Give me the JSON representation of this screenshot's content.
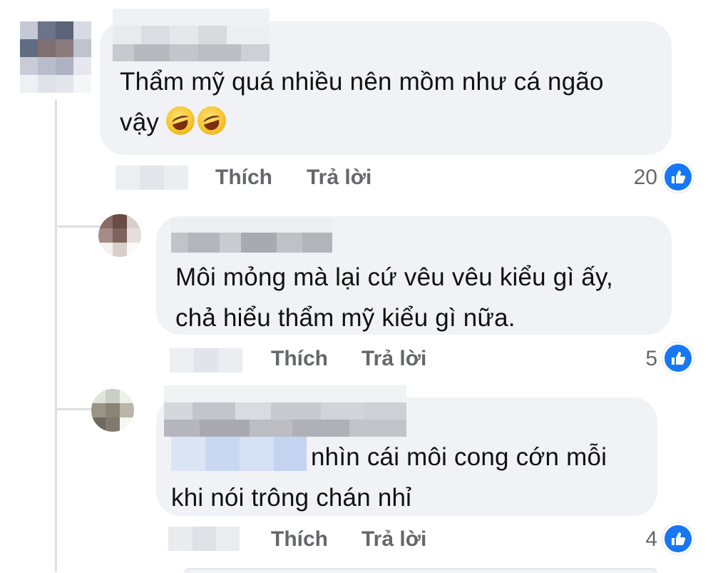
{
  "comments": [
    {
      "text_line1": "Thẩm mỹ quá nhiều nên mồm như cá ngão",
      "text_line2": "vậy",
      "emoji_names": [
        "rolling-on-floor-laughing-icon",
        "rolling-on-floor-laughing-icon"
      ],
      "like_label": "Thích",
      "reply_label": "Trả lời",
      "reaction_count": "20",
      "reaction_icon": "like-icon"
    },
    {
      "text_line1": "Môi mỏng mà lại cứ vêu vêu kiểu gì ấy,",
      "text_line2": "chả hiểu thẩm mỹ kiểu gì nữa.",
      "like_label": "Thích",
      "reply_label": "Trả lời",
      "reaction_count": "5",
      "reaction_icon": "like-icon"
    },
    {
      "text_line1": "nhìn cái môi cong cớn mỗi",
      "text_line2": "khi nói trông chán nhỉ",
      "like_label": "Thích",
      "reply_label": "Trả lời",
      "reaction_count": "4",
      "reaction_icon": "like-icon"
    }
  ],
  "colors": {
    "bubble": "#f0f2f5",
    "action_text": "#65676b",
    "like_blue": "#1877f2",
    "thread_line": "#dcdee3"
  }
}
